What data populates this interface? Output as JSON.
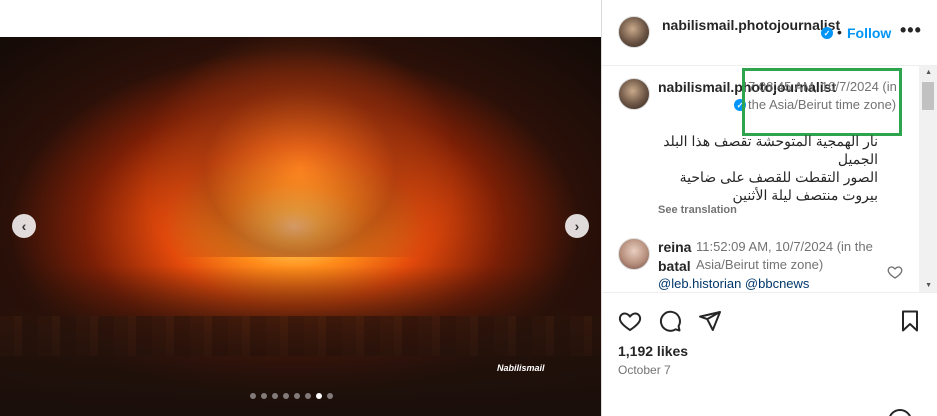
{
  "media": {
    "watermark": "Nabilismail",
    "carousel_dots": 8,
    "active_dot_index": 6,
    "prev_arrow": "chevron-left-icon",
    "next_arrow": "chevron-right-icon"
  },
  "header": {
    "username": "nabilismail.photojournalist",
    "separator": "•",
    "follow_label": "Follow",
    "more_label": "•••"
  },
  "comments": [
    {
      "username": "nabilismail.photojournalist",
      "verified": true,
      "timestamp": "7:08:45 AM, 10/7/2024 (in the Asia/Beirut time zone)",
      "text": "نار الهمجية المتوحشة تقصف هذا البلد الجميل\nالصور التقطت للقصف على ضاحية بيروت منتصف ليلة الأثنين",
      "see_translation": "See translation"
    },
    {
      "username": "reina batal",
      "timestamp": "11:52:09 AM, 10/7/2024 (in the Asia/Beirut time zone)",
      "text": "@leb.historian @bbcnews"
    }
  ],
  "actions": {
    "likes": "1,192 likes",
    "date": "October 7"
  },
  "colors": {
    "accent": "#0095f6",
    "highlight": "#2ea44f",
    "muted": "#737373"
  }
}
